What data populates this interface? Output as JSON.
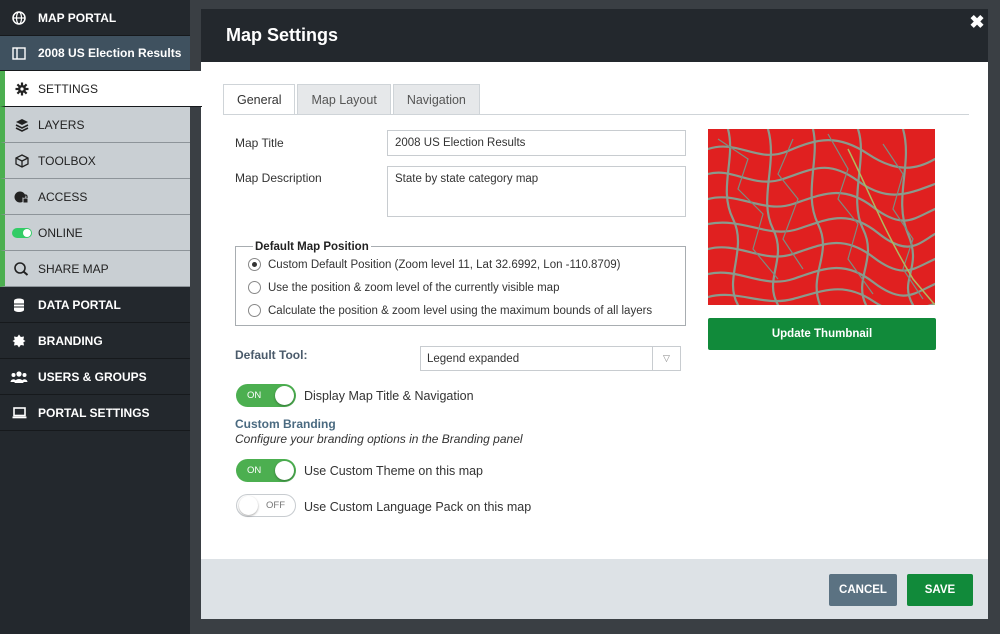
{
  "sidebar": {
    "items": [
      {
        "label": "MAP PORTAL",
        "icon": "globe-icon"
      },
      {
        "label": "2008 US Election Results",
        "icon": "map-panel-icon"
      },
      {
        "label": "SETTINGS",
        "icon": "gear-icon"
      },
      {
        "label": "LAYERS",
        "icon": "layers-icon"
      },
      {
        "label": "TOOLBOX",
        "icon": "cube-icon"
      },
      {
        "label": "ACCESS",
        "icon": "globe-lock-icon"
      },
      {
        "label": "ONLINE",
        "icon": "toggle-icon"
      },
      {
        "label": "SHARE MAP",
        "icon": "share-globe-icon"
      },
      {
        "label": "DATA PORTAL",
        "icon": "database-icon"
      },
      {
        "label": "BRANDING",
        "icon": "badge-icon"
      },
      {
        "label": "USERS & GROUPS",
        "icon": "users-icon"
      },
      {
        "label": "PORTAL SETTINGS",
        "icon": "laptop-icon"
      }
    ]
  },
  "modal": {
    "title": "Map Settings",
    "close_glyph": "✖",
    "tabs": [
      {
        "label": "General"
      },
      {
        "label": "Map Layout"
      },
      {
        "label": "Navigation"
      }
    ],
    "map_title_label": "Map Title",
    "map_title_value": "2008 US Election Results",
    "map_description_label": "Map Description",
    "map_description_value": "State by state category map",
    "default_position": {
      "legend": "Default Map Position",
      "options": [
        {
          "label": "Custom Default Position (Zoom level 11, Lat 32.6992, Lon -110.8709)",
          "selected": true
        },
        {
          "label": "Use the position & zoom level of the currently visible map",
          "selected": false
        },
        {
          "label": "Calculate the position & zoom level using the maximum bounds of all layers",
          "selected": false
        }
      ]
    },
    "default_tool_label": "Default Tool:",
    "default_tool_value": "Legend expanded",
    "toggles": [
      {
        "state": "ON",
        "label": "Display Map Title & Navigation"
      },
      {
        "state": "ON",
        "label": "Use Custom Theme on this map"
      },
      {
        "state": "OFF",
        "label": "Use Custom Language Pack on this map"
      }
    ],
    "custom_branding_title": "Custom Branding",
    "custom_branding_subtitle": "Configure your branding options in the Branding panel",
    "update_thumbnail_label": "Update Thumbnail",
    "cancel_label": "CANCEL",
    "save_label": "SAVE"
  },
  "colors": {
    "accent_green": "#118a3a",
    "toggle_green": "#4caf50",
    "sidebar_dark": "#23282d",
    "thumbnail_red": "#e02020"
  }
}
